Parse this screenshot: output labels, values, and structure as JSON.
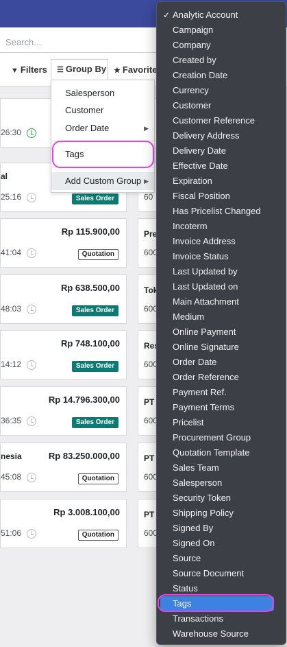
{
  "search": {
    "placeholder": "Search..."
  },
  "toolbar": {
    "filters_label": "Filters",
    "groupby_label": "Group By",
    "favorites_label": "Favorite"
  },
  "groupby_menu": {
    "items": [
      "Salesperson",
      "Customer",
      "Order Date"
    ],
    "tags_label": "Tags",
    "add_custom_label": "Add Custom Group"
  },
  "cards": [
    {
      "customer": "",
      "amount": "",
      "time": "26:30",
      "status": ""
    },
    {
      "customer": "al",
      "amount": "",
      "time": "25:16",
      "status": "Sales Order"
    },
    {
      "customer": "",
      "amount": "Rp 115.900,00",
      "time": "41:04",
      "status": "Quotation"
    },
    {
      "customer": "",
      "amount": "Rp 638.500,00",
      "time": "48:03",
      "status": "Sales Order"
    },
    {
      "customer": "",
      "amount": "Rp 748.100,00",
      "time": "14:12",
      "status": "Sales Order"
    },
    {
      "customer": "",
      "amount": "Rp 14.796.300,00",
      "time": "36:35",
      "status": "Sales Order"
    },
    {
      "customer": "nesia",
      "amount": "Rp 83.250.000,00",
      "time": "45:08",
      "status": "Quotation"
    },
    {
      "customer": "",
      "amount": "Rp 3.008.100,00",
      "time": "51:06",
      "status": "Quotation"
    }
  ],
  "cards_right": [
    {
      "name": "",
      "num": ""
    },
    {
      "name": "",
      "num": "60"
    },
    {
      "name": "Pre",
      "num": "600"
    },
    {
      "name": "Tok",
      "num": "600"
    },
    {
      "name": "Res",
      "num": "600"
    },
    {
      "name": "PT",
      "num": "600"
    },
    {
      "name": "PT",
      "num": "600"
    },
    {
      "name": "PT",
      "num": "600"
    }
  ],
  "custom_group_options": [
    "Analytic Account",
    "Campaign",
    "Company",
    "Created by",
    "Creation Date",
    "Currency",
    "Customer",
    "Customer Reference",
    "Delivery Address",
    "Delivery Date",
    "Effective Date",
    "Expiration",
    "Fiscal Position",
    "Has Pricelist Changed",
    "Incoterm",
    "Invoice Address",
    "Invoice Status",
    "Last Updated by",
    "Last Updated on",
    "Main Attachment",
    "Medium",
    "Online Payment",
    "Online Signature",
    "Order Date",
    "Order Reference",
    "Payment Ref.",
    "Payment Terms",
    "Pricelist",
    "Procurement Group",
    "Quotation Template",
    "Sales Team",
    "Salesperson",
    "Security Token",
    "Shipping Policy",
    "Signed By",
    "Signed On",
    "Source",
    "Source Document",
    "Status",
    "Tags",
    "Transactions",
    "Warehouse Source"
  ],
  "custom_group_checked": "Analytic Account",
  "custom_group_selected": "Tags",
  "colors": {
    "topbar": "#3b4a9c",
    "sales_order_badge": "#0b7a73",
    "selected_option": "#3d82e0",
    "highlight": "#e642e8"
  }
}
